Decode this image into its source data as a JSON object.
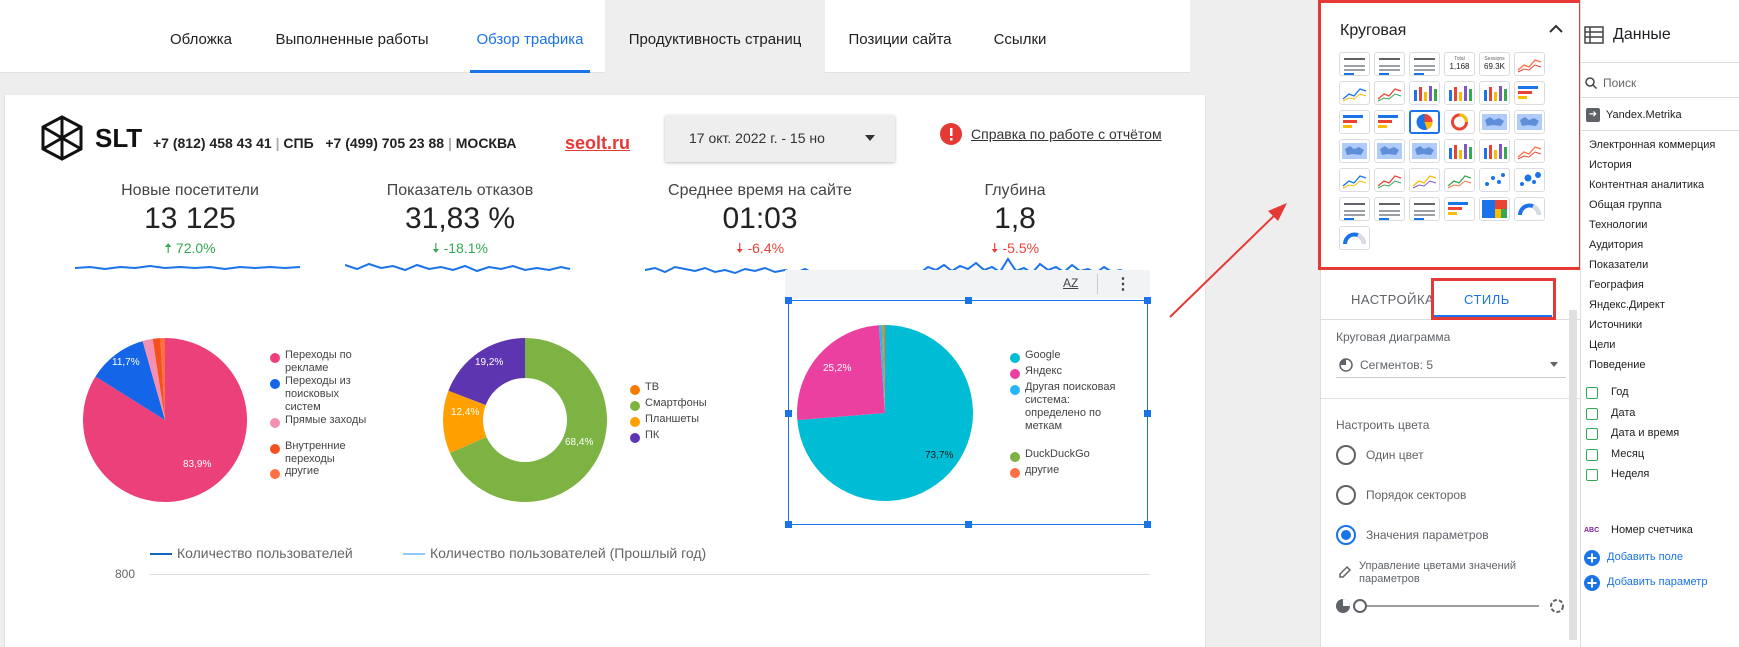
{
  "nav": {
    "tabs": [
      {
        "label": "Обложка"
      },
      {
        "label": "Выполненные работы"
      },
      {
        "label": "Обзор трафика"
      },
      {
        "label": "Продуктивность страниц"
      },
      {
        "label": "Позиции сайта"
      },
      {
        "label": "Ссылки"
      }
    ]
  },
  "header": {
    "logo_text": "SLT",
    "phone1": "+7 (812) 458 43 41",
    "city1": "СПБ",
    "phone2": "+7 (499) 705 23 88",
    "city2": "МОСКВА",
    "site": "seolt.ru",
    "date_range": "17 окт. 2022 г. - 15 но",
    "help_link": "Справка по работе с отчётом"
  },
  "kpis": [
    {
      "label": "Новые посетители",
      "value": "13 125",
      "delta": "72.0%",
      "dir": "up",
      "color": "#34a853"
    },
    {
      "label": "Показатель отказов",
      "value": "31,83 %",
      "delta": "-18.1%",
      "dir": "down",
      "color": "#34a853"
    },
    {
      "label": "Среднее время на сайте",
      "value": "01:03",
      "delta": "-6.4%",
      "dir": "down",
      "color": "#ea4335"
    },
    {
      "label": "Глубина",
      "value": "1,8",
      "delta": "-5.5%",
      "dir": "down",
      "color": "#ea4335"
    }
  ],
  "charts": {
    "pie1": {
      "legend": [
        "Переходы по рекламе",
        "Переходы из поисковых систем",
        "Прямые заходы",
        "Внутренние переходы",
        "другие"
      ],
      "colors": [
        "#ec407a",
        "#1565e8",
        "#f48fb1",
        "#f4511e",
        "#ff7043"
      ],
      "values": [
        83.9,
        11.7,
        2.0,
        1.5,
        0.9
      ],
      "labels": [
        "83,9%",
        "11,7%"
      ]
    },
    "donut": {
      "legend": [
        "ТВ",
        "Смартфоны",
        "Планшеты",
        "ПК"
      ],
      "colors": [
        "#f57c00",
        "#7cb342",
        "#ffa000",
        "#5e35b1"
      ],
      "values": [
        0.0,
        68.4,
        12.4,
        19.2
      ],
      "labels": [
        "68,4%",
        "12,4%",
        "19,2%"
      ]
    },
    "pie3": {
      "legend": [
        "Google",
        "Яндекс",
        "Другая поисковая система: определено по меткам",
        "DuckDuckGo",
        "другие"
      ],
      "colors": [
        "#00bcd4",
        "#ec40a0",
        "#29b6f6",
        "#7cb342",
        "#ff7043"
      ],
      "values": [
        73.7,
        25.2,
        0.5,
        0.3,
        0.3
      ],
      "labels": [
        "73,7%",
        "25,2%"
      ]
    }
  },
  "line_legend": {
    "series1": "Количество пользователей",
    "series2": "Количество пользователей (Прошлый год)",
    "ytick": "800"
  },
  "toolbar_icons": {
    "sort": "AZ",
    "more": "⋮"
  },
  "style_panel": {
    "title": "Круговая",
    "tab_setup": "НАСТРОЙКА",
    "tab_style": "СТИЛЬ",
    "section_pie": "Круговая диаграмма",
    "segments": "Сегментов: 5",
    "section_colors": "Настроить цвета",
    "opt1": "Один цвет",
    "opt2": "Порядок секторов",
    "opt3": "Значения параметров",
    "manage": "Управление цветами значений параметров"
  },
  "data_panel": {
    "title": "Данные",
    "search": "Поиск",
    "source": "Yandex.Metrika",
    "groups": [
      "Электронная коммерция",
      "История",
      "Контентная аналитика",
      "Общая группа",
      "Технологии",
      "Аудитория",
      "Показатели",
      "География",
      "Яндекс.Директ",
      "Источники",
      "Цели",
      "Поведение"
    ],
    "date_fields": [
      "Год",
      "Дата",
      "Дата и время",
      "Месяц",
      "Неделя"
    ],
    "abc_field": "Номер счетчика",
    "abc_badge": "ABC",
    "add_field": "Добавить поле",
    "add_param": "Добавить параметр"
  },
  "chart_type_thumbs": {
    "total": "Total",
    "total_value": "1,168",
    "sessions": "Sessions",
    "sessions_value": "69.3K"
  }
}
